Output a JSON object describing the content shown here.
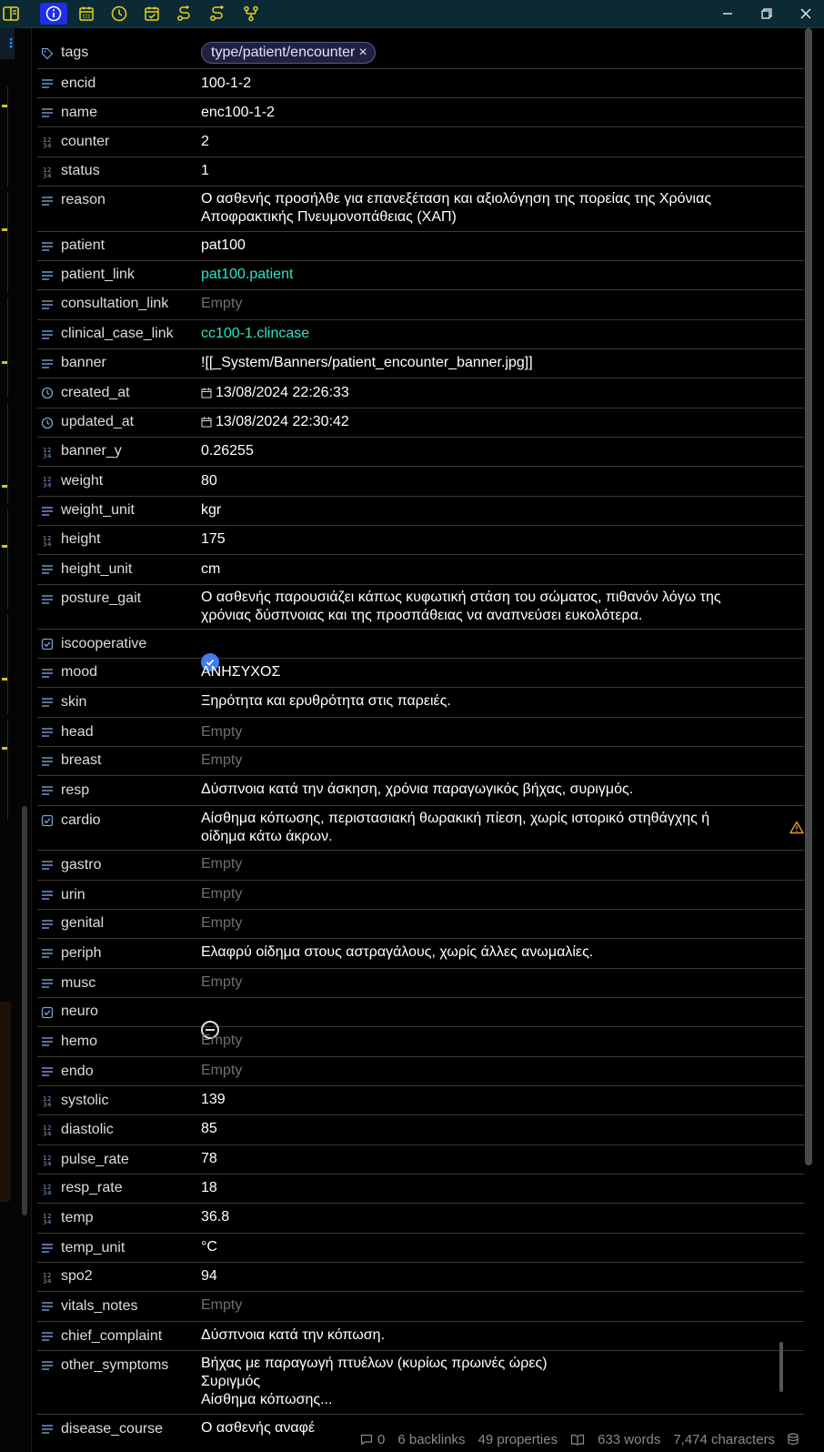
{
  "colors": {
    "accent": "#1e2fe6",
    "link": "#2fe3c5",
    "empty": "#6f6f6f",
    "warning": "#e0a020",
    "check": "#3f7cf0"
  },
  "toolbar": {
    "icons": [
      "info-icon",
      "calendar-icon",
      "clock-icon",
      "calendar-check-icon",
      "route-icon",
      "route-alt-icon",
      "git-fork-icon"
    ],
    "window": [
      "minimize-icon",
      "restore-icon",
      "close-icon"
    ]
  },
  "properties": {
    "tags": {
      "key": "tags",
      "tag": "type/patient/encounter",
      "remove": "×"
    },
    "encid": {
      "key": "encid",
      "value": "100-1-2"
    },
    "name": {
      "key": "name",
      "value": "enc100-1-2"
    },
    "counter": {
      "key": "counter",
      "value": "2"
    },
    "status": {
      "key": "status",
      "value": "1"
    },
    "reason": {
      "key": "reason",
      "value": "Ο ασθενής προσήλθε για επανεξέταση και αξιολόγηση της πορείας της Χρόνιας Αποφρακτικής Πνευμονοπάθειας (ΧΑΠ)"
    },
    "patient": {
      "key": "patient",
      "value": "pat100"
    },
    "patient_link": {
      "key": "patient_link",
      "value": "pat100.patient"
    },
    "consultation_link": {
      "key": "consultation_link",
      "value": "Empty"
    },
    "clinical_case_link": {
      "key": "clinical_case_link",
      "value": "cc100-1.clincase"
    },
    "banner": {
      "key": "banner",
      "value": "![[_System/Banners/patient_encounter_banner.jpg]]"
    },
    "created_at": {
      "key": "created_at",
      "value": "13/08/2024 22:26:33"
    },
    "updated_at": {
      "key": "updated_at",
      "value": "13/08/2024 22:30:42"
    },
    "banner_y": {
      "key": "banner_y",
      "value": "0.26255"
    },
    "weight": {
      "key": "weight",
      "value": "80"
    },
    "weight_unit": {
      "key": "weight_unit",
      "value": "kgr"
    },
    "height": {
      "key": "height",
      "value": "175"
    },
    "height_unit": {
      "key": "height_unit",
      "value": "cm"
    },
    "posture_gait": {
      "key": "posture_gait",
      "value": "Ο ασθενής παρουσιάζει κάπως κυφωτική στάση του σώματος, πιθανόν λόγω της χρόνιας δύσπνοιας και της προσπάθειας να αναπνεύσει ευκολότερα."
    },
    "iscooperative": {
      "key": "iscooperative",
      "checked": true
    },
    "mood": {
      "key": "mood",
      "value": "ΑΝΗΣΥΧΟΣ"
    },
    "skin": {
      "key": "skin",
      "value": "Ξηρότητα και ερυθρότητα στις παρειές."
    },
    "head": {
      "key": "head",
      "value": "Empty"
    },
    "breast": {
      "key": "breast",
      "value": "Empty"
    },
    "resp": {
      "key": "resp",
      "value": "Δύσπνοια κατά την άσκηση, χρόνια παραγωγικός βήχας, συριγμός."
    },
    "cardio": {
      "key": "cardio",
      "value": "Αίσθημα κόπωσης, περιστασιακή θωρακική πίεση, χωρίς ιστορικό στηθάγχης ή οίδημα κάτω άκρων."
    },
    "gastro": {
      "key": "gastro",
      "value": "Empty"
    },
    "urin": {
      "key": "urin",
      "value": "Empty"
    },
    "genital": {
      "key": "genital",
      "value": "Empty"
    },
    "periph": {
      "key": "periph",
      "value": "Ελαφρύ οίδημα στους αστραγάλους, χωρίς άλλες ανωμαλίες."
    },
    "musc": {
      "key": "musc",
      "value": "Empty"
    },
    "neuro": {
      "key": "neuro",
      "checked": null
    },
    "hemo": {
      "key": "hemo",
      "value": "Empty"
    },
    "endo": {
      "key": "endo",
      "value": "Empty"
    },
    "systolic": {
      "key": "systolic",
      "value": "139"
    },
    "diastolic": {
      "key": "diastolic",
      "value": "85"
    },
    "pulse_rate": {
      "key": "pulse_rate",
      "value": "78"
    },
    "resp_rate": {
      "key": "resp_rate",
      "value": "18"
    },
    "temp": {
      "key": "temp",
      "value": "36.8"
    },
    "temp_unit": {
      "key": "temp_unit",
      "value": "°C"
    },
    "spo2": {
      "key": "spo2",
      "value": "94"
    },
    "vitals_notes": {
      "key": "vitals_notes",
      "value": "Empty"
    },
    "chief_complaint": {
      "key": "chief_complaint",
      "value": "Δύσπνοια κατά την κόπωση."
    },
    "other_symptoms": {
      "key": "other_symptoms",
      "value": "Βήχας με παραγωγή πτυέλων (κυρίως πρωινές ώρες)\nΣυριγμός\nΑίσθημα κόπωσης..."
    },
    "disease_course": {
      "key": "disease_course",
      "value": "Ο ασθενής αναφέ"
    }
  },
  "statusbar": {
    "comments": "0",
    "backlinks": "6 backlinks",
    "properties": "49 properties",
    "words": "633 words",
    "characters": "7,474 characters"
  }
}
